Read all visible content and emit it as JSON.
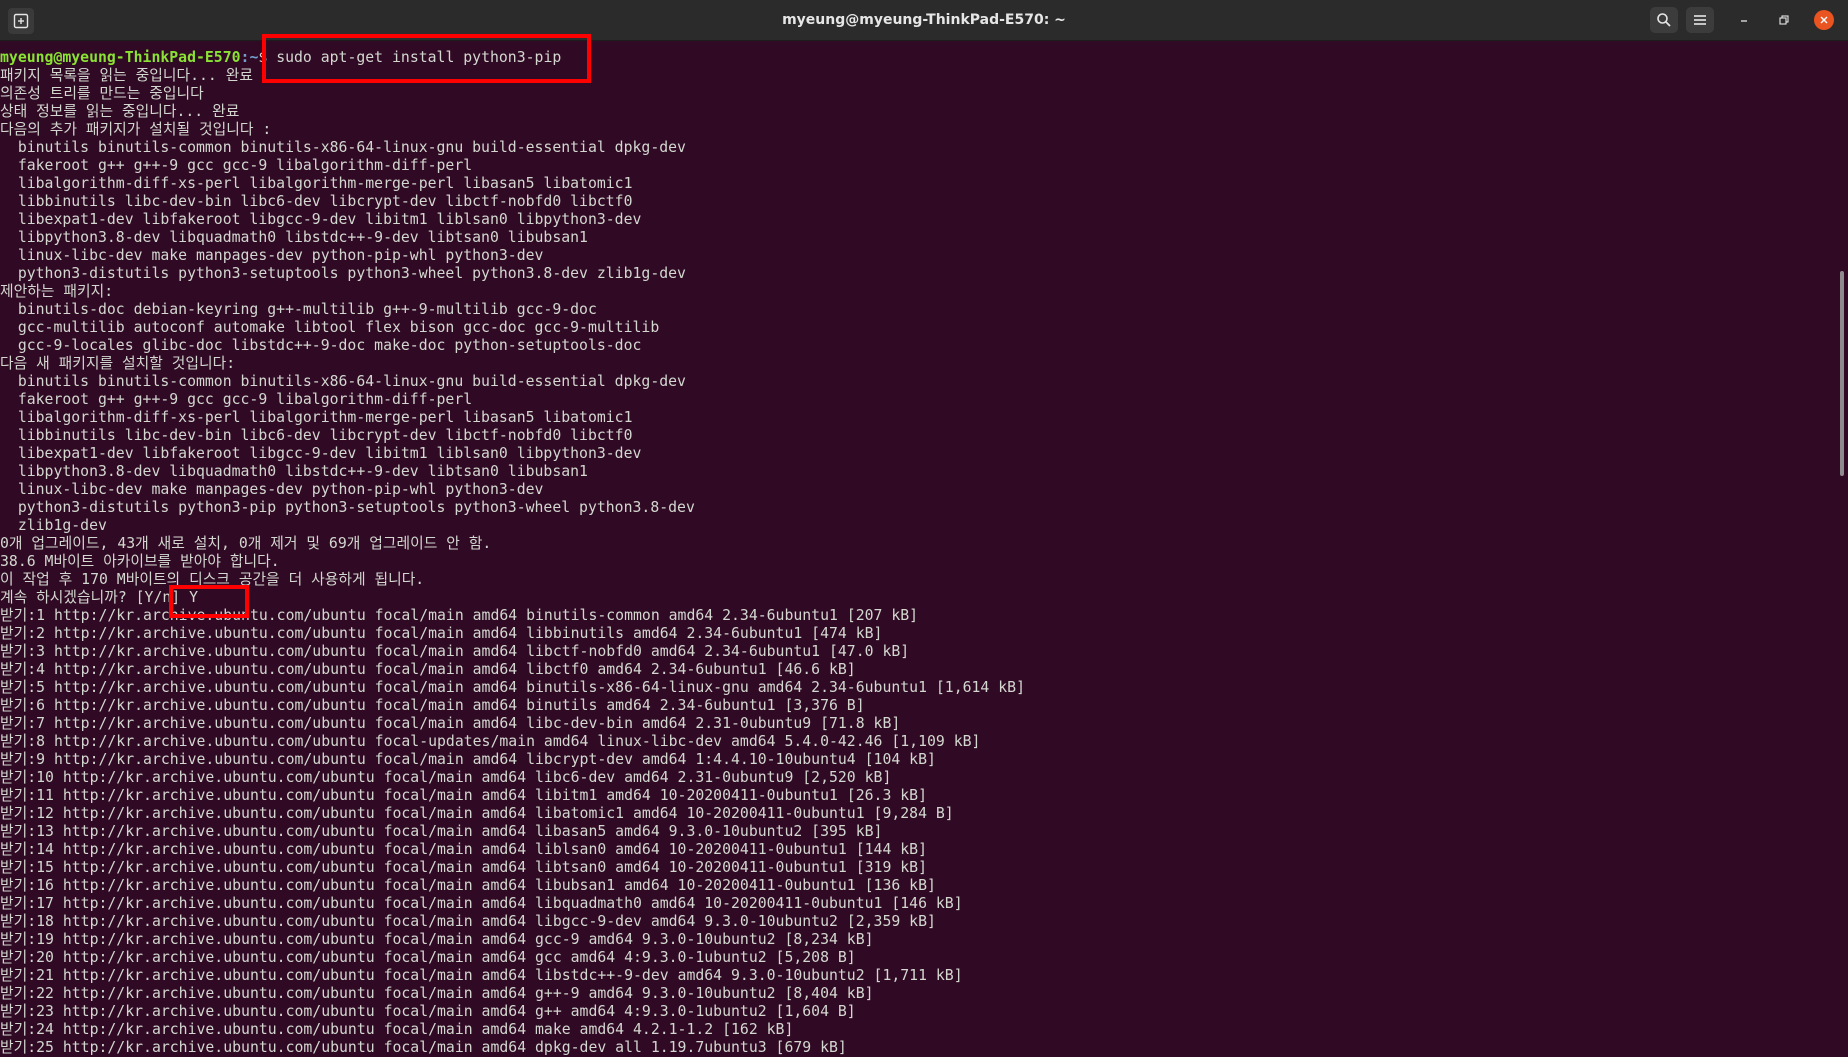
{
  "window": {
    "title": "myeung@myeung-ThinkPad-E570: ~",
    "icons": {
      "new_tab": "new-tab-icon",
      "search": "search-icon",
      "menu": "hamburger-menu-icon",
      "minimize": "minimize-icon",
      "maximize": "maximize-icon",
      "close": "close-icon"
    },
    "close_color": "#e95420"
  },
  "prompt": {
    "user_host": "myeung@myeung-ThinkPad-E570",
    "path": ":~",
    "symbol": "$ ",
    "command": "sudo apt-get install python3-pip"
  },
  "output": [
    "패키지 목록을 읽는 중입니다... 완료",
    "의존성 트리를 만드는 중입니다",
    "상태 정보를 읽는 중입니다... 완료",
    "다음의 추가 패키지가 설치될 것입니다 :",
    "  binutils binutils-common binutils-x86-64-linux-gnu build-essential dpkg-dev",
    "  fakeroot g++ g++-9 gcc gcc-9 libalgorithm-diff-perl",
    "  libalgorithm-diff-xs-perl libalgorithm-merge-perl libasan5 libatomic1",
    "  libbinutils libc-dev-bin libc6-dev libcrypt-dev libctf-nobfd0 libctf0",
    "  libexpat1-dev libfakeroot libgcc-9-dev libitm1 liblsan0 libpython3-dev",
    "  libpython3.8-dev libquadmath0 libstdc++-9-dev libtsan0 libubsan1",
    "  linux-libc-dev make manpages-dev python-pip-whl python3-dev",
    "  python3-distutils python3-setuptools python3-wheel python3.8-dev zlib1g-dev",
    "제안하는 패키지:",
    "  binutils-doc debian-keyring g++-multilib g++-9-multilib gcc-9-doc",
    "  gcc-multilib autoconf automake libtool flex bison gcc-doc gcc-9-multilib",
    "  gcc-9-locales glibc-doc libstdc++-9-doc make-doc python-setuptools-doc",
    "다음 새 패키지를 설치할 것입니다:",
    "  binutils binutils-common binutils-x86-64-linux-gnu build-essential dpkg-dev",
    "  fakeroot g++ g++-9 gcc gcc-9 libalgorithm-diff-perl",
    "  libalgorithm-diff-xs-perl libalgorithm-merge-perl libasan5 libatomic1",
    "  libbinutils libc-dev-bin libc6-dev libcrypt-dev libctf-nobfd0 libctf0",
    "  libexpat1-dev libfakeroot libgcc-9-dev libitm1 liblsan0 libpython3-dev",
    "  libpython3.8-dev libquadmath0 libstdc++-9-dev libtsan0 libubsan1",
    "  linux-libc-dev make manpages-dev python-pip-whl python3-dev",
    "  python3-distutils python3-pip python3-setuptools python3-wheel python3.8-dev",
    "  zlib1g-dev",
    "0개 업그레이드, 43개 새로 설치, 0개 제거 및 69개 업그레이드 안 함.",
    "38.6 M바이트 아카이브를 받아야 합니다.",
    "이 작업 후 170 M바이트의 디스크 공간을 더 사용하게 됩니다.",
    "계속 하시겠습니까? [Y/n] Y",
    "받기:1 http://kr.archive.ubuntu.com/ubuntu focal/main amd64 binutils-common amd64 2.34-6ubuntu1 [207 kB]",
    "받기:2 http://kr.archive.ubuntu.com/ubuntu focal/main amd64 libbinutils amd64 2.34-6ubuntu1 [474 kB]",
    "받기:3 http://kr.archive.ubuntu.com/ubuntu focal/main amd64 libctf-nobfd0 amd64 2.34-6ubuntu1 [47.0 kB]",
    "받기:4 http://kr.archive.ubuntu.com/ubuntu focal/main amd64 libctf0 amd64 2.34-6ubuntu1 [46.6 kB]",
    "받기:5 http://kr.archive.ubuntu.com/ubuntu focal/main amd64 binutils-x86-64-linux-gnu amd64 2.34-6ubuntu1 [1,614 kB]",
    "받기:6 http://kr.archive.ubuntu.com/ubuntu focal/main amd64 binutils amd64 2.34-6ubuntu1 [3,376 B]",
    "받기:7 http://kr.archive.ubuntu.com/ubuntu focal/main amd64 libc-dev-bin amd64 2.31-0ubuntu9 [71.8 kB]",
    "받기:8 http://kr.archive.ubuntu.com/ubuntu focal-updates/main amd64 linux-libc-dev amd64 5.4.0-42.46 [1,109 kB]",
    "받기:9 http://kr.archive.ubuntu.com/ubuntu focal/main amd64 libcrypt-dev amd64 1:4.4.10-10ubuntu4 [104 kB]",
    "받기:10 http://kr.archive.ubuntu.com/ubuntu focal/main amd64 libc6-dev amd64 2.31-0ubuntu9 [2,520 kB]",
    "받기:11 http://kr.archive.ubuntu.com/ubuntu focal/main amd64 libitm1 amd64 10-20200411-0ubuntu1 [26.3 kB]",
    "받기:12 http://kr.archive.ubuntu.com/ubuntu focal/main amd64 libatomic1 amd64 10-20200411-0ubuntu1 [9,284 B]",
    "받기:13 http://kr.archive.ubuntu.com/ubuntu focal/main amd64 libasan5 amd64 9.3.0-10ubuntu2 [395 kB]",
    "받기:14 http://kr.archive.ubuntu.com/ubuntu focal/main amd64 liblsan0 amd64 10-20200411-0ubuntu1 [144 kB]",
    "받기:15 http://kr.archive.ubuntu.com/ubuntu focal/main amd64 libtsan0 amd64 10-20200411-0ubuntu1 [319 kB]",
    "받기:16 http://kr.archive.ubuntu.com/ubuntu focal/main amd64 libubsan1 amd64 10-20200411-0ubuntu1 [136 kB]",
    "받기:17 http://kr.archive.ubuntu.com/ubuntu focal/main amd64 libquadmath0 amd64 10-20200411-0ubuntu1 [146 kB]",
    "받기:18 http://kr.archive.ubuntu.com/ubuntu focal/main amd64 libgcc-9-dev amd64 9.3.0-10ubuntu2 [2,359 kB]",
    "받기:19 http://kr.archive.ubuntu.com/ubuntu focal/main amd64 gcc-9 amd64 9.3.0-10ubuntu2 [8,234 kB]",
    "받기:20 http://kr.archive.ubuntu.com/ubuntu focal/main amd64 gcc amd64 4:9.3.0-1ubuntu2 [5,208 B]",
    "받기:21 http://kr.archive.ubuntu.com/ubuntu focal/main amd64 libstdc++-9-dev amd64 9.3.0-10ubuntu2 [1,711 kB]",
    "받기:22 http://kr.archive.ubuntu.com/ubuntu focal/main amd64 g++-9 amd64 9.3.0-10ubuntu2 [8,404 kB]",
    "받기:23 http://kr.archive.ubuntu.com/ubuntu focal/main amd64 g++ amd64 4:9.3.0-1ubuntu2 [1,604 B]",
    "받기:24 http://kr.archive.ubuntu.com/ubuntu focal/main amd64 make amd64 4.2.1-1.2 [162 kB]",
    "받기:25 http://kr.archive.ubuntu.com/ubuntu focal/main amd64 dpkg-dev all 1.19.7ubuntu3 [679 kB]"
  ],
  "scrollbar": {
    "position": 0.23,
    "visible_fraction": 0.2
  }
}
